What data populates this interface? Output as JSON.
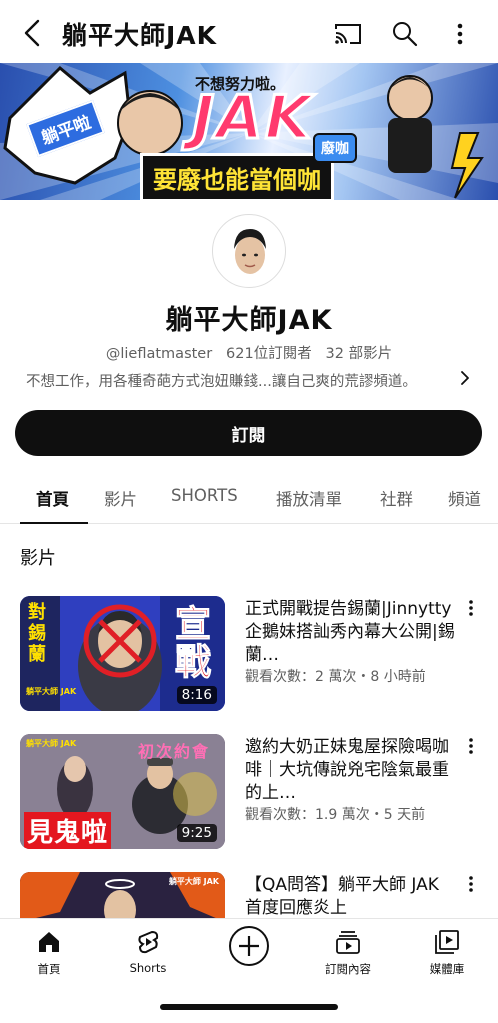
{
  "header": {
    "title": "躺平大師JAK",
    "icons": [
      "back-icon",
      "cast-icon",
      "search-icon",
      "more-vert-icon"
    ]
  },
  "banner": {
    "logo_text": "JAK",
    "slogan_top": "不想努力啦。",
    "slogan": "要廢也能當個咖",
    "tag_left": "躺平啦",
    "tag_right": "廢咖"
  },
  "channel": {
    "name": "躺平大師JAK",
    "handle": "@lieflatmaster",
    "subscribers": "621位訂閱者",
    "videos": "32 部影片",
    "description": "不想工作，用各種奇葩方式泡妞賺錢...讓自己爽的荒謬頻道。",
    "subscribe_label": "訂閱"
  },
  "tabs": [
    {
      "label": "首頁",
      "active": true
    },
    {
      "label": "影片",
      "active": false
    },
    {
      "label": "SHORTS",
      "active": false
    },
    {
      "label": "播放清單",
      "active": false
    },
    {
      "label": "社群",
      "active": false
    },
    {
      "label": "頻道",
      "active": false
    }
  ],
  "section": {
    "label": "影片"
  },
  "videos": [
    {
      "title": "正式開戰提告錫蘭|Jinnytty企鵝妹搭訕秀內幕大公開|錫蘭…",
      "meta": "觀看次數：2 萬次・8 小時前",
      "duration": "8:16",
      "thumb_text_left": "對錫蘭",
      "thumb_text_right": "宣戰",
      "thumb_brand": "躺平大師 JAK"
    },
    {
      "title": "邀約大奶正妹鬼屋探險喝咖啡｜大坑傳說兇宅陰氣最重的上…",
      "meta": "觀看次數：1.9 萬次・5 天前",
      "duration": "9:25",
      "thumb_text_top": "初次約會",
      "thumb_text_bottom": "見鬼啦",
      "thumb_brand": "躺平大師 JAK"
    },
    {
      "title": "【QA問答】躺平大師 JAK 首度回應炎上",
      "meta": "",
      "duration": "",
      "thumb_brand": "躺平大師 JAK"
    }
  ],
  "bottom_nav": [
    {
      "label": "首頁",
      "icon": "home-icon"
    },
    {
      "label": "Shorts",
      "icon": "shorts-icon"
    },
    {
      "label": "",
      "icon": "create-icon"
    },
    {
      "label": "訂閱內容",
      "icon": "subscriptions-icon"
    },
    {
      "label": "媒體庫",
      "icon": "library-icon"
    }
  ],
  "colors": {
    "primary_text": "#0f0f0f",
    "secondary_text": "#606060",
    "subscribe_bg": "#0f0f0f",
    "banner_accent": "#ff3a6e"
  }
}
